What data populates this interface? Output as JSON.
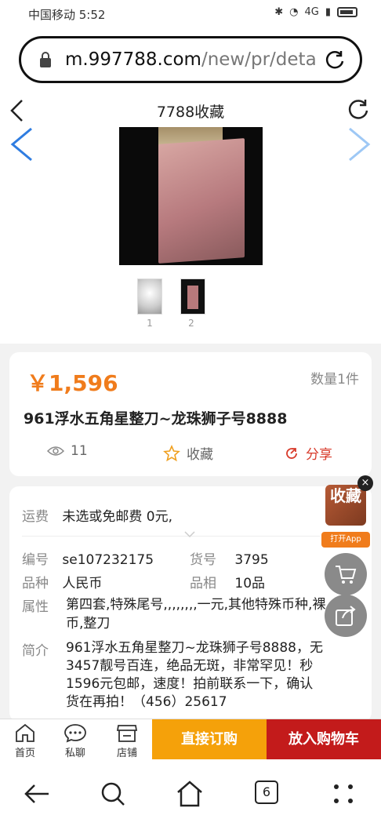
{
  "status_bar": {
    "carrier_time": "中国移动 5:52",
    "network": "4G"
  },
  "browser": {
    "url_domain": "m.997788.com",
    "url_path": "/new/pr/detai"
  },
  "header": {
    "title": "7788收藏"
  },
  "gallery": {
    "thumbnail_numbers": [
      "1",
      "2"
    ]
  },
  "product": {
    "price": "￥1,596",
    "quantity": "数量1件",
    "title": "961浮水五角星整刀~龙珠狮子号8888",
    "views": "11",
    "favorite_label": "收藏",
    "share_label": "分享"
  },
  "details": {
    "shipping_label": "运费",
    "shipping_value": "未选或免邮费 0元,",
    "number_label": "编号",
    "number_value": "se107232175",
    "item_no_label": "货号",
    "item_no_value": "3795",
    "category_label": "品种",
    "category_value": "人民币",
    "grade_label": "品相",
    "grade_value": "10品",
    "attr_label": "属性",
    "attr_value_line1": "第四套,特殊尾号,,,,,,,,一元,其他特殊币种,裸",
    "attr_value_line2": "币,整刀",
    "intro_label": "简介",
    "intro_line1": "961浮水五角星整刀~龙珠狮子号8888，无",
    "intro_line2": "3457靓号百连，绝品无斑，非常罕见！秒",
    "intro_line3": "1596元包邮，速度！拍前联系一下，确认",
    "intro_line4": "货在再拍！（456）25617"
  },
  "float": {
    "app_logo_text": "收藏",
    "open_app": "打开App",
    "close": "×"
  },
  "bottom_bar": {
    "home": "首页",
    "chat": "私聊",
    "shop": "店铺",
    "buy_now": "直接订购",
    "add_to_cart": "放入购物车"
  },
  "system_nav": {
    "tab_count": "6"
  },
  "colors": {
    "price": "#f07c1c",
    "buy": "#f5a10a",
    "cart": "#c31b1b",
    "share": "#d83a2a"
  }
}
